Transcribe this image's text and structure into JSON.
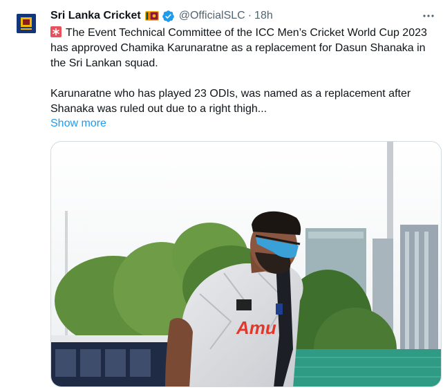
{
  "tweet": {
    "display_name": "Sri Lanka Cricket",
    "flag_icon": "sri-lanka-flag-icon",
    "verified_icon": "verified-badge-icon",
    "handle": "@OfficialSLC",
    "separator": "·",
    "time": "18h",
    "more_icon": "more-options-icon",
    "emoji_icon": "red-square-asterisk-icon",
    "paragraph_1": "The Event Technical Committee of the ICC Men’s Cricket World Cup 2023 has approved Chamika Karunaratne as a replacement for Dasun Shanaka in the Sri Lankan squad.",
    "paragraph_2": "Karunaratne who has played 23 ODIs, was named as a replacement after Shanaka was ruled out due to a right thigh...",
    "show_more": "Show more",
    "media": {
      "description_icon": "photo-cricketer",
      "shirt_text": "Amu"
    }
  },
  "colors": {
    "link": "#1d9bf0",
    "text_primary": "#0f1419",
    "text_secondary": "#536471",
    "verified": "#1d9bf0",
    "avatar_bg": "#13367a"
  }
}
